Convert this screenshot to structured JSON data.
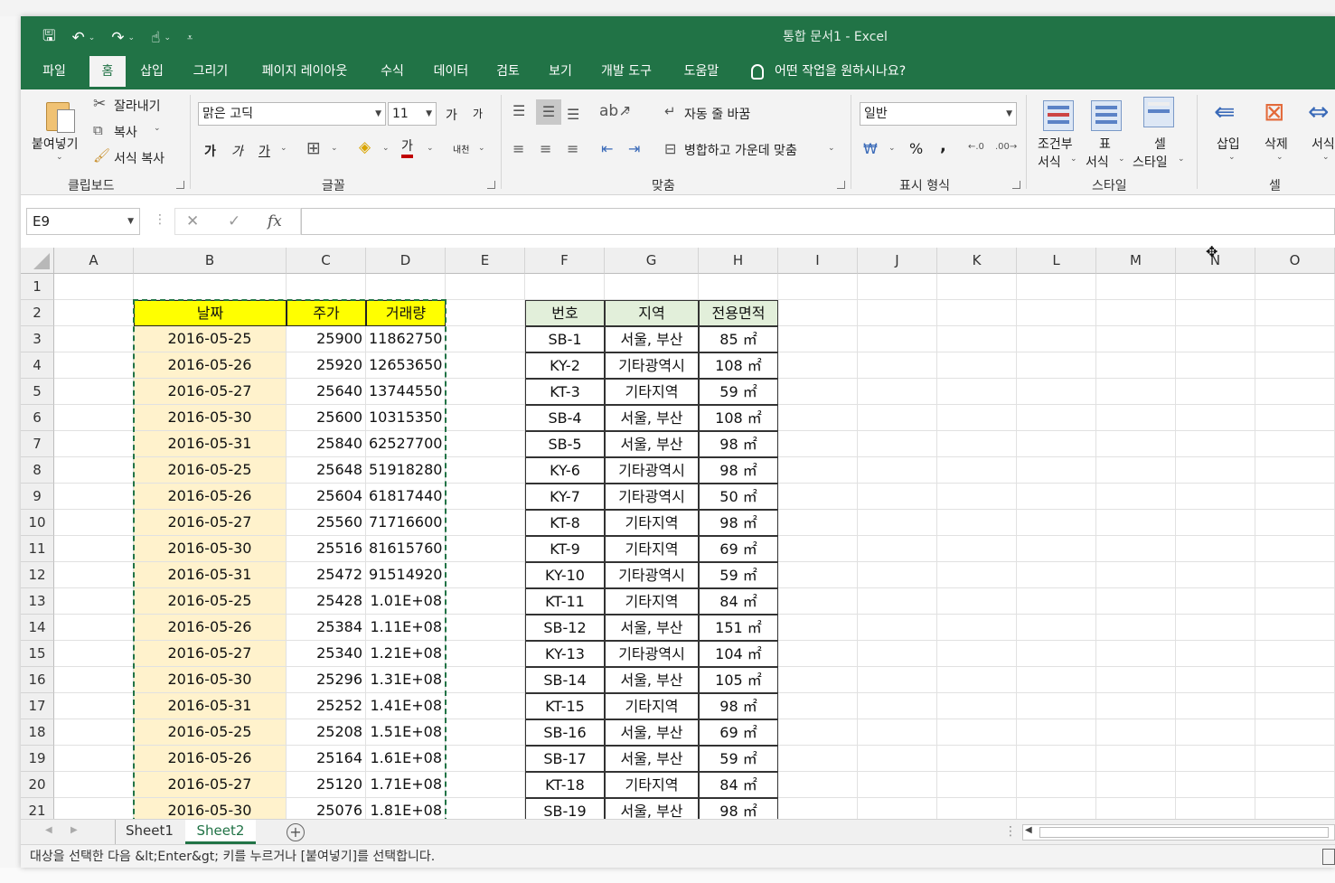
{
  "window": {
    "title": "통합 문서1  -  Excel"
  },
  "menu": {
    "tabs": [
      "파일",
      "홈",
      "삽입",
      "그리기",
      "페이지 레이아웃",
      "수식",
      "데이터",
      "검토",
      "보기",
      "개발 도구",
      "도움말"
    ],
    "active": "홈",
    "tell_me": "어떤 작업을 원하시나요?"
  },
  "ribbon": {
    "clipboard": {
      "paste": "붙여넣기",
      "cut": "잘라내기",
      "copy": "복사",
      "format_painter": "서식 복사",
      "label": "클립보드"
    },
    "font": {
      "name": "맑은 고딕",
      "size": "11",
      "grow": "가",
      "shrink": "가",
      "bold": "가",
      "italic": "가",
      "underline": "가",
      "font_color": "가",
      "phonetic": "내천",
      "label": "글꼴"
    },
    "alignment": {
      "wrap": "자동 줄 바꿈",
      "merge": "병합하고 가운데 맞춤",
      "label": "맞춤"
    },
    "number": {
      "format": "일반",
      "percent": "%",
      "comma": ",",
      "label": "표시 형식"
    },
    "styles": {
      "conditional_line1": "조건부",
      "conditional_line2": "서식",
      "table_line1": "표",
      "table_line2": "서식",
      "cell_line1": "셀",
      "cell_line2": "스타일",
      "label": "스타일"
    },
    "cells": {
      "insert": "삽입",
      "delete": "삭제",
      "format": "서식",
      "label": "셀"
    }
  },
  "formula_bar": {
    "name_box": "E9",
    "cancel": "✕",
    "enter": "✓",
    "fx": "fx",
    "content": ""
  },
  "columns": [
    "A",
    "B",
    "C",
    "D",
    "E",
    "F",
    "G",
    "H",
    "I",
    "J",
    "K",
    "L",
    "M",
    "N",
    "O"
  ],
  "rows": [
    "1",
    "2",
    "3",
    "4",
    "5",
    "6",
    "7",
    "8",
    "9",
    "10",
    "11",
    "12",
    "13",
    "14",
    "15",
    "16",
    "17",
    "18",
    "19",
    "20",
    "21"
  ],
  "table1": {
    "headers": [
      "날짜",
      "주가",
      "거래량"
    ],
    "rows": [
      [
        "2016-05-25",
        "25900",
        "11862750"
      ],
      [
        "2016-05-26",
        "25920",
        "12653650"
      ],
      [
        "2016-05-27",
        "25640",
        "13744550"
      ],
      [
        "2016-05-30",
        "25600",
        "10315350"
      ],
      [
        "2016-05-31",
        "25840",
        "62527700"
      ],
      [
        "2016-05-25",
        "25648",
        "51918280"
      ],
      [
        "2016-05-26",
        "25604",
        "61817440"
      ],
      [
        "2016-05-27",
        "25560",
        "71716600"
      ],
      [
        "2016-05-30",
        "25516",
        "81615760"
      ],
      [
        "2016-05-31",
        "25472",
        "91514920"
      ],
      [
        "2016-05-25",
        "25428",
        "1.01E+08"
      ],
      [
        "2016-05-26",
        "25384",
        "1.11E+08"
      ],
      [
        "2016-05-27",
        "25340",
        "1.21E+08"
      ],
      [
        "2016-05-30",
        "25296",
        "1.31E+08"
      ],
      [
        "2016-05-31",
        "25252",
        "1.41E+08"
      ],
      [
        "2016-05-25",
        "25208",
        "1.51E+08"
      ],
      [
        "2016-05-26",
        "25164",
        "1.61E+08"
      ],
      [
        "2016-05-27",
        "25120",
        "1.71E+08"
      ],
      [
        "2016-05-30",
        "25076",
        "1.81E+08"
      ]
    ]
  },
  "table2": {
    "headers": [
      "번호",
      "지역",
      "전용면적"
    ],
    "rows": [
      [
        "SB-1",
        "서울, 부산",
        "85 ㎡"
      ],
      [
        "KY-2",
        "기타광역시",
        "108 ㎡"
      ],
      [
        "KT-3",
        "기타지역",
        "59 ㎡"
      ],
      [
        "SB-4",
        "서울, 부산",
        "108 ㎡"
      ],
      [
        "SB-5",
        "서울, 부산",
        "98 ㎡"
      ],
      [
        "KY-6",
        "기타광역시",
        "98 ㎡"
      ],
      [
        "KY-7",
        "기타광역시",
        "50 ㎡"
      ],
      [
        "KT-8",
        "기타지역",
        "98 ㎡"
      ],
      [
        "KT-9",
        "기타지역",
        "69 ㎡"
      ],
      [
        "KY-10",
        "기타광역시",
        "59 ㎡"
      ],
      [
        "KT-11",
        "기타지역",
        "84 ㎡"
      ],
      [
        "SB-12",
        "서울, 부산",
        "151 ㎡"
      ],
      [
        "KY-13",
        "기타광역시",
        "104 ㎡"
      ],
      [
        "SB-14",
        "서울, 부산",
        "105 ㎡"
      ],
      [
        "KT-15",
        "기타지역",
        "98 ㎡"
      ],
      [
        "SB-16",
        "서울, 부산",
        "69 ㎡"
      ],
      [
        "SB-17",
        "서울, 부산",
        "59 ㎡"
      ],
      [
        "KT-18",
        "기타지역",
        "84 ㎡"
      ],
      [
        "SB-19",
        "서울, 부산",
        "98 ㎡"
      ]
    ]
  },
  "sheets": {
    "tabs": [
      "Sheet1",
      "Sheet2"
    ],
    "active": "Sheet2",
    "add": "+"
  },
  "status": {
    "message": "대상을 선택한 다음 &lt;Enter&gt; 키를 누르거나 [붙여넣기]를 선택합니다."
  },
  "colors": {
    "excel_green": "#217346",
    "header_yellow": "#ffff00",
    "date_fill": "#fff2cc",
    "header_green": "#e2efda"
  },
  "icons": [
    "save-icon",
    "undo-icon",
    "redo-icon",
    "touch-mode-icon",
    "qat-customize-icon",
    "lightbulb-icon",
    "scissors-icon",
    "copy-icon",
    "format-painter-icon",
    "borders-icon",
    "fill-color-icon",
    "cell-cursor-icon"
  ]
}
